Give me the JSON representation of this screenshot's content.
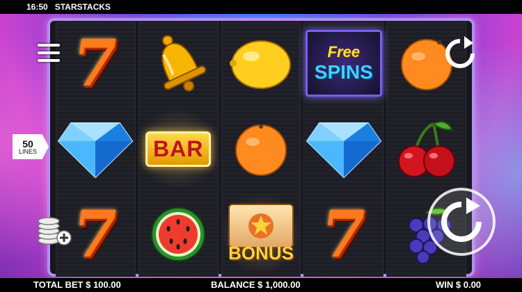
{
  "status": {
    "time": "16:50",
    "app_name": "STARSTACKS"
  },
  "controls": {
    "lines_value": "50",
    "lines_label": "LINES",
    "menu_icon": "hamburger-menu-icon",
    "coins_icon": "coin-stack-plus-icon",
    "autoplay_icon": "autoplay-arrow-icon",
    "spin_icon": "spin-arrow-icon"
  },
  "reels": [
    [
      {
        "symbol": "seven",
        "text": "7"
      },
      {
        "symbol": "diamond"
      },
      {
        "symbol": "seven",
        "text": "7"
      }
    ],
    [
      {
        "symbol": "bell"
      },
      {
        "symbol": "bar",
        "text": "BAR",
        "highlight": true
      },
      {
        "symbol": "watermelon"
      }
    ],
    [
      {
        "symbol": "lemon"
      },
      {
        "symbol": "orange"
      },
      {
        "symbol": "bonus",
        "text": "BONUS",
        "highlight": true
      }
    ],
    [
      {
        "symbol": "free-spins",
        "text_line1": "Free",
        "text_line2": "SPINS"
      },
      {
        "symbol": "diamond"
      },
      {
        "symbol": "seven",
        "text": "7"
      }
    ],
    [
      {
        "symbol": "orange"
      },
      {
        "symbol": "cherries"
      },
      {
        "symbol": "grapes"
      }
    ]
  ],
  "footer": {
    "total_bet": "TOTAL BET $ 100.00",
    "balance": "BALANCE $ 1,000.00",
    "win": "WIN $ 0.00"
  },
  "colors": {
    "frame": "#b38ef2",
    "status_bar": "#000000",
    "background_blue": "#2f6fff",
    "background_pink": "#c843d0"
  }
}
